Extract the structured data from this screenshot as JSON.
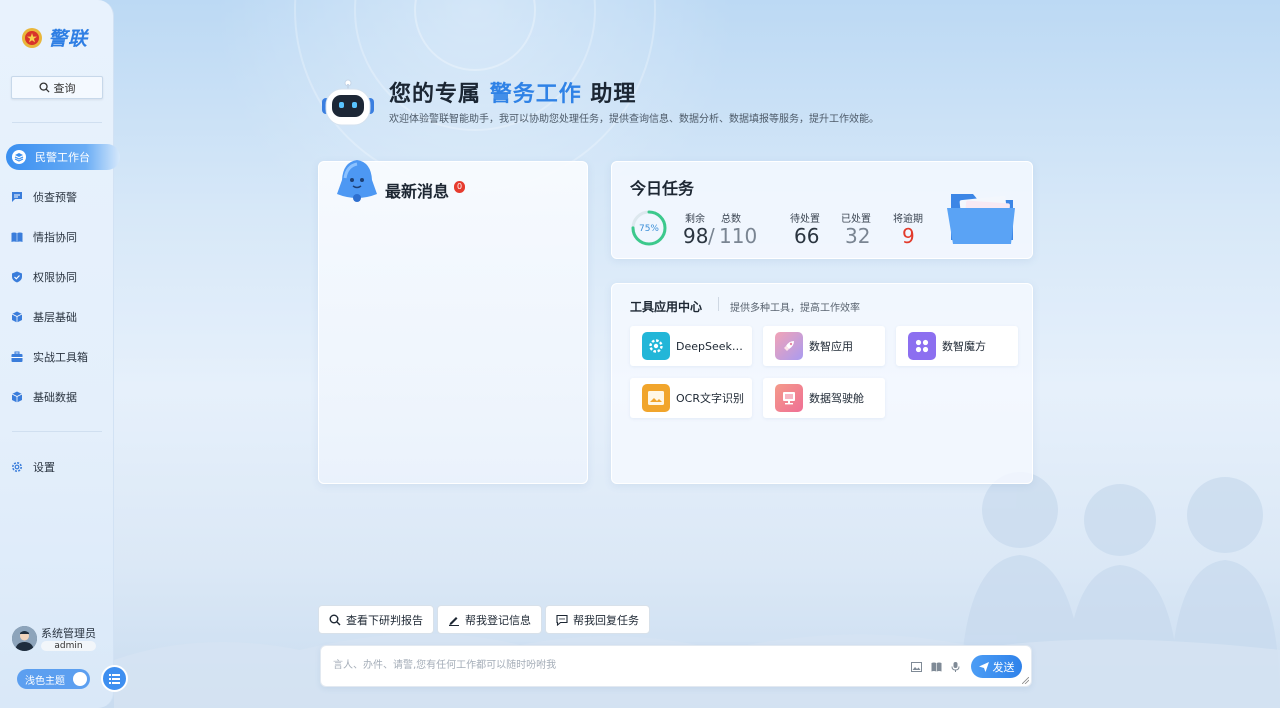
{
  "app": {
    "logo_text": "警联"
  },
  "sidebar": {
    "query_label": "查询",
    "items": [
      {
        "label": "民警工作台",
        "icon": "layers-icon",
        "active": true
      },
      {
        "label": "侦查预警",
        "icon": "chat-icon"
      },
      {
        "label": "情指协同",
        "icon": "book-icon"
      },
      {
        "label": "权限协同",
        "icon": "shield-icon"
      },
      {
        "label": "基层基础",
        "icon": "cube-icon"
      },
      {
        "label": "实战工具箱",
        "icon": "toolbox-icon"
      },
      {
        "label": "基础数据",
        "icon": "cube-icon"
      }
    ],
    "settings_label": "设置",
    "user": {
      "name": "系统管理员",
      "role": "admin"
    },
    "theme_label": "浅色主题"
  },
  "hero": {
    "title_prefix": "您的专属",
    "title_highlight": "警务工作",
    "title_suffix": "助理",
    "subtitle": "欢迎体验警联智能助手，我可以协助您处理任务，提供查询信息、数据分析、数据填报等服务，提升工作效能。"
  },
  "messages": {
    "title": "最新消息",
    "badge": "0"
  },
  "tasks": {
    "title": "今日任务",
    "progress_label": "75%",
    "progress": 0.75,
    "remaining_label": "剩余",
    "remaining": "98",
    "total_label": "总数",
    "total": "110",
    "pending_label": "待处置",
    "pending": "66",
    "done_label": "已处置",
    "done": "32",
    "overdue_label": "将逾期",
    "overdue": "9"
  },
  "tools": {
    "title": "工具应用中心",
    "subtitle": "提供多种工具，提高工作效率",
    "items": [
      {
        "label": "DeepSeek…",
        "icon": "gear-icon",
        "color": "#22b6d8"
      },
      {
        "label": "数智应用",
        "icon": "rocket-icon",
        "color": "#e98aa7"
      },
      {
        "label": "数智魔方",
        "icon": "cube-grid-icon",
        "color": "#8c6ff0"
      },
      {
        "label": "OCR文字识别",
        "icon": "image-icon",
        "color": "#f1a52c"
      },
      {
        "label": "数据驾驶舱",
        "icon": "monitor-icon",
        "color": "#f08383"
      }
    ]
  },
  "quick_actions": [
    {
      "label": "查看下研判报告",
      "icon": "search-icon"
    },
    {
      "label": "帮我登记信息",
      "icon": "pen-icon"
    },
    {
      "label": "帮我回复任务",
      "icon": "chat-icon"
    }
  ],
  "composer": {
    "placeholder": "言人、办件、请警,您有任何工作都可以随时吩咐我",
    "send_label": "发送"
  }
}
